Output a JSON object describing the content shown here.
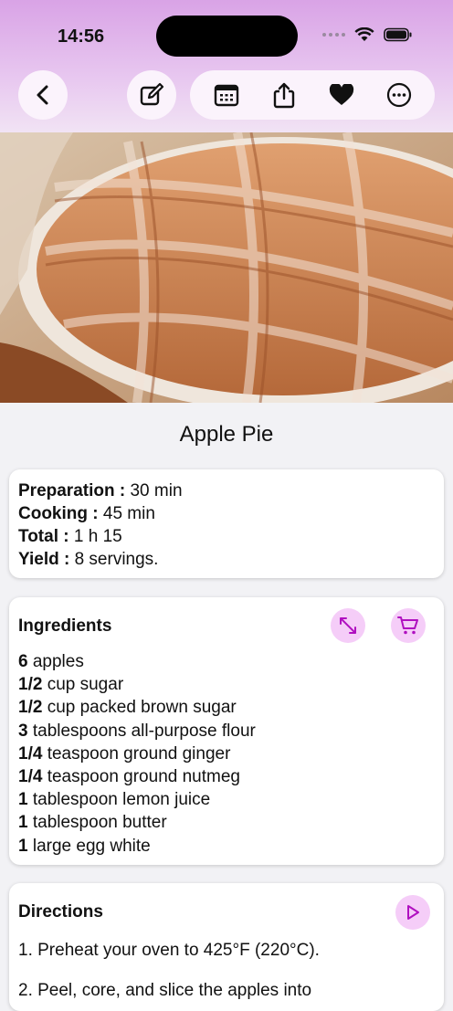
{
  "status": {
    "time": "14:56"
  },
  "toolbar": {
    "icons": [
      "back-icon",
      "edit-icon",
      "calendar-icon",
      "share-icon",
      "heart-icon",
      "more-icon"
    ],
    "accent": "#e8c8f0"
  },
  "recipe": {
    "title": "Apple Pie",
    "info": [
      {
        "label": "Preparation :",
        "value": " 30 min"
      },
      {
        "label": "Cooking :",
        "value": " 45 min"
      },
      {
        "label": "Total :",
        "value": " 1 h 15"
      },
      {
        "label": "Yield :",
        "value": " 8 servings."
      }
    ],
    "ingredients_title": "Ingredients",
    "ingredients": [
      {
        "qty": "6",
        "text": " apples"
      },
      {
        "qty": "1/2",
        "text": " cup sugar"
      },
      {
        "qty": "1/2",
        "text": " cup packed brown sugar"
      },
      {
        "qty": "3",
        "text": " tablespoons all-purpose flour"
      },
      {
        "qty": "1/4",
        "text": " teaspoon ground ginger"
      },
      {
        "qty": "1/4",
        "text": " teaspoon ground nutmeg"
      },
      {
        "qty": "1",
        "text": " tablespoon lemon juice"
      },
      {
        "qty": "1",
        "text": " tablespoon butter"
      },
      {
        "qty": "1",
        "text": " large egg white"
      }
    ],
    "directions_title": "Directions",
    "directions": [
      "1. Preheat your oven to 425°F (220°C).",
      "2. Peel, core, and slice the apples into"
    ]
  }
}
